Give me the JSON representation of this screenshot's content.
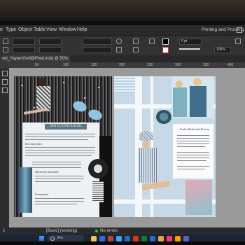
{
  "menubar": {
    "items": [
      "e",
      "Type",
      "Object",
      "Table",
      "View",
      "Window",
      "Help"
    ],
    "workspace": "Printing and Proofing"
  },
  "controlbar": {
    "stroke_weight": "0 pt",
    "zoom": "100%"
  },
  "tab": {
    "title": "vel_YayamGraf@Pixel.indd @ 50%"
  },
  "ruler": {
    "ticks": [
      "50",
      "100",
      "150",
      "200",
      "250",
      "300",
      "350",
      "400",
      "450"
    ]
  },
  "left_page": {
    "heading": "1960 FÜTİSH KANAL",
    "section1": "Dür Sağ Şenler",
    "section2": "Merdivelk Mezrubler",
    "section3": "Konuşmalar"
  },
  "right_page": {
    "heading": "Kadın Modasında Devrim"
  },
  "status": {
    "page": "1",
    "style": "[Basic] (working)",
    "errors": "No errors"
  },
  "taskbar": {
    "search": "Ara"
  },
  "colors": {
    "ui_dark": "#2a2a2c",
    "pasteboard": "#9a9a9a",
    "accent_blue": "#5d7686",
    "page_blue": "#c7d9e6"
  }
}
